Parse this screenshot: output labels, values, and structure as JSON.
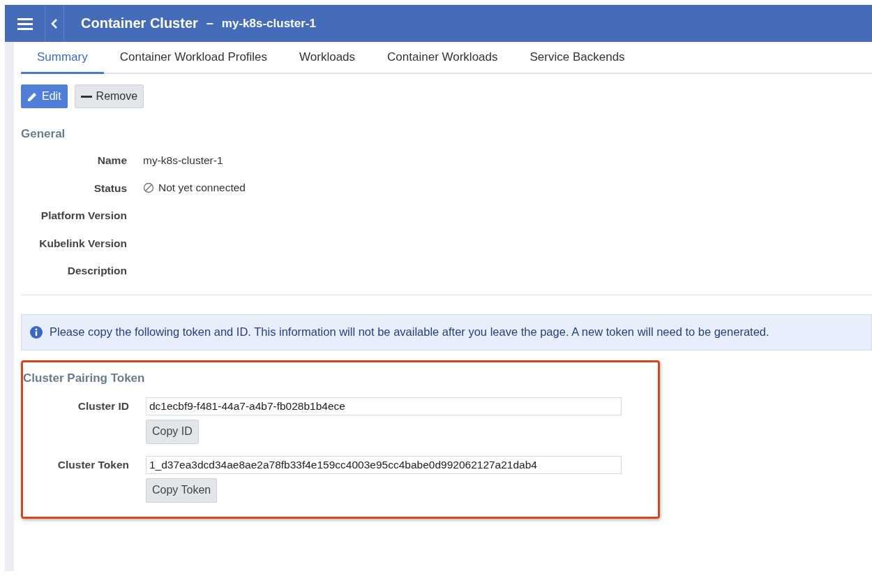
{
  "header": {
    "title": "Container Cluster",
    "separator": "–",
    "subtitle": "my-k8s-cluster-1"
  },
  "tabs": [
    {
      "label": "Summary",
      "selected": true
    },
    {
      "label": "Container Workload Profiles",
      "selected": false
    },
    {
      "label": "Workloads",
      "selected": false
    },
    {
      "label": "Container Workloads",
      "selected": false
    },
    {
      "label": "Service Backends",
      "selected": false
    }
  ],
  "actions": [
    {
      "label": "Edit",
      "kind": "primary"
    },
    {
      "label": "Remove",
      "kind": "secondary"
    }
  ],
  "general": {
    "heading": "General",
    "fields": [
      {
        "label": "Name",
        "value": "my-k8s-cluster-1"
      },
      {
        "label": "Status",
        "value": "Not yet connected",
        "kind": "status"
      },
      {
        "label": "Platform Version"
      },
      {
        "label": "Kubelink Version"
      },
      {
        "label": "Description"
      }
    ]
  },
  "notice": "Please copy the following token and ID. This information will not be available after you leave the page. A new token will need to be generated.",
  "pairing": {
    "heading": "Cluster Pairing Token",
    "fields": [
      {
        "label": "Cluster ID",
        "value": "dc1ecbf9-f481-44a7-a4b7-fb028b1b4ece",
        "button": "Copy ID"
      },
      {
        "label": "Cluster Token",
        "value": "1_d37ea3dcd34ae8ae2a78fb33f4e159cc4003e95cc4babe0d992062127a21dab4",
        "button": "Copy Token"
      }
    ]
  }
}
